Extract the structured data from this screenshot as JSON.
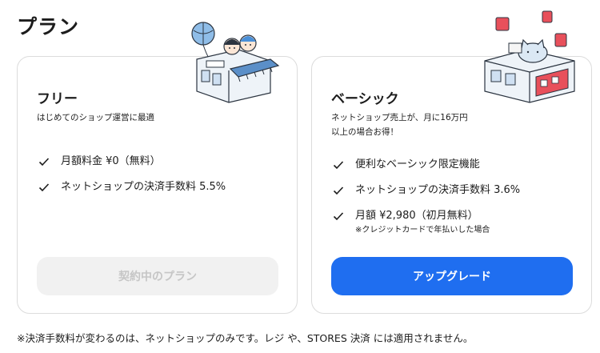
{
  "page": {
    "title": "プラン",
    "footnote": "※決済手数料が変わるのは、ネットショップのみです。レジ や、STORES 決済 には適用されません。"
  },
  "plans": {
    "free": {
      "name": "フリー",
      "description": "はじめてのショップ運営に最適",
      "features": [
        "月額料金 ¥0（無料）",
        "ネットショップの決済手数料 5.5%"
      ],
      "button_label": "契約中のプラン"
    },
    "basic": {
      "name": "ベーシック",
      "description_line1": "ネットショップ売上が、月に16万円",
      "description_line2": "以上の場合お得！",
      "features": [
        "便利なベーシック限定機能",
        "ネットショップの決済手数料 3.6%",
        "月額 ¥2,980（初月無料）"
      ],
      "price_note": "※クレジットカードで年払いした場合",
      "button_label": "アップグレード"
    }
  },
  "colors": {
    "accent": "#1f6ef0",
    "disabled_bg": "#f1f1f1",
    "disabled_text": "#c6c6c6",
    "card_border": "#dcdcdc"
  }
}
